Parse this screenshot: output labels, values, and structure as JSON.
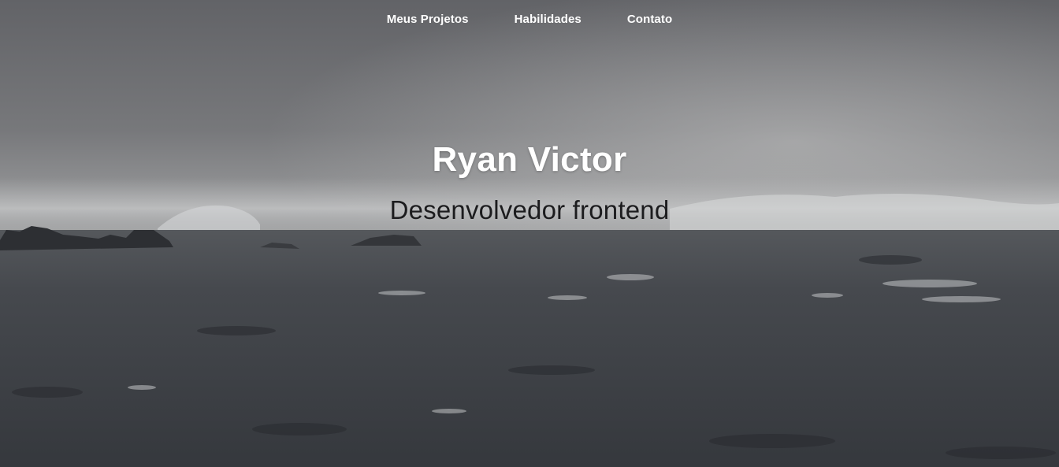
{
  "nav": {
    "items": [
      {
        "label": "Meus Projetos"
      },
      {
        "label": "Habilidades"
      },
      {
        "label": "Contato"
      }
    ]
  },
  "hero": {
    "title": "Ryan Victor",
    "subtitle": "Desenvolvedor frontend"
  },
  "colors": {
    "sky": "#6b6c70",
    "horizon_mist": "#a9aaab",
    "sea": "#3e4146",
    "text_light": "#ffffff",
    "text_dark": "#1c1c1e"
  }
}
